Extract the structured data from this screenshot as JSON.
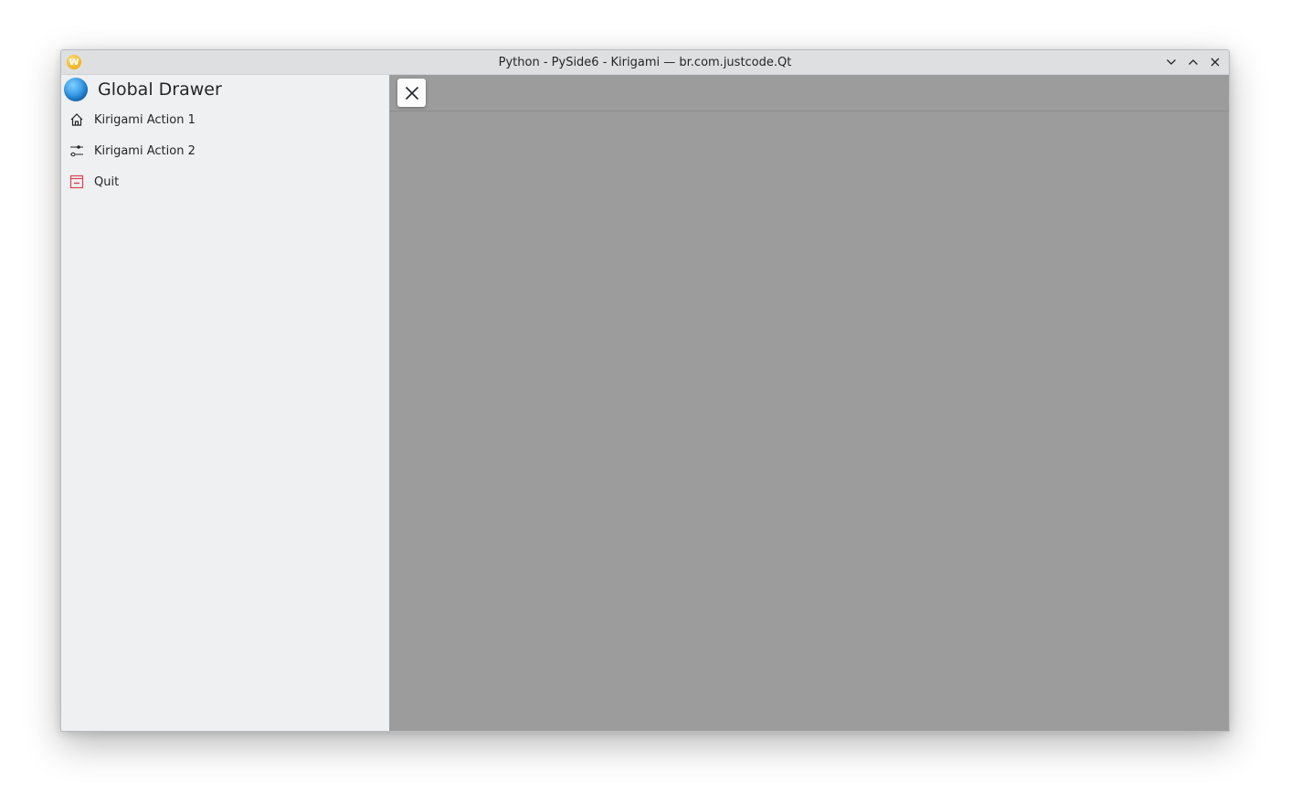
{
  "window": {
    "title": "Python - PySide6 - Kirigami — br.com.justcode.Qt",
    "app_icon": "W",
    "controls": [
      {
        "name": "minimize",
        "icon": "chevron-down-icon"
      },
      {
        "name": "maximize",
        "icon": "chevron-up-icon"
      },
      {
        "name": "close",
        "icon": "close-icon"
      }
    ]
  },
  "drawer": {
    "title": "Global Drawer",
    "title_icon": "globe-icon",
    "items": [
      {
        "label": "Kirigami Action 1",
        "icon": "home-icon"
      },
      {
        "label": "Kirigami Action 2",
        "icon": "settings-sliders-icon"
      },
      {
        "label": "Quit",
        "icon": "quit-icon",
        "icon_color": "#da4453"
      }
    ]
  },
  "content": {
    "close_drawer_icon": "close-icon",
    "overlay_color": "#9c9c9c"
  }
}
